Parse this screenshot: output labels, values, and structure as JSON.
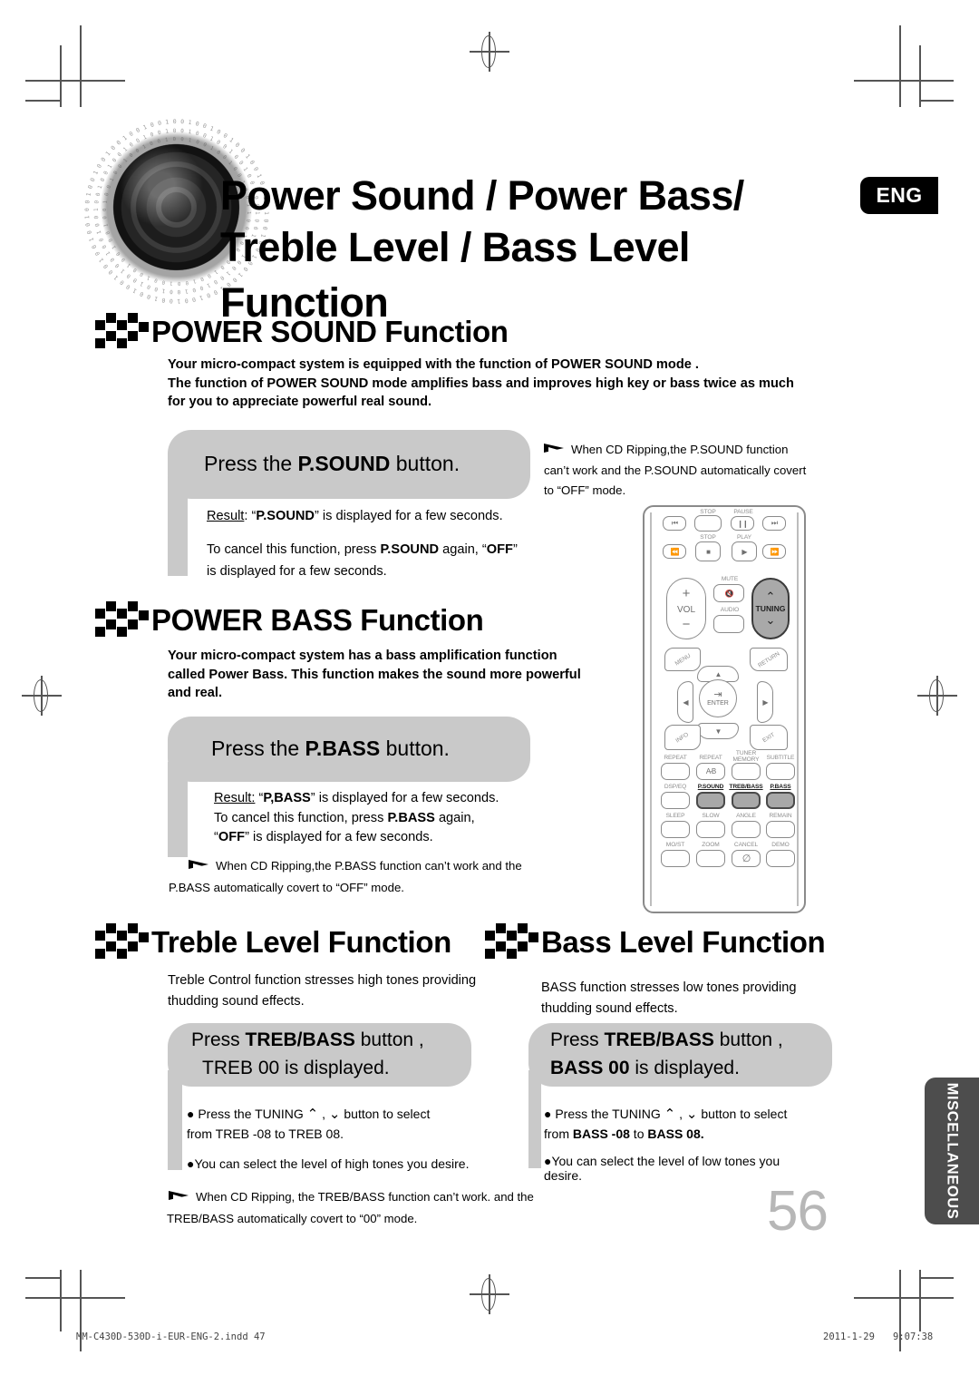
{
  "header": {
    "title_line1": "Power Sound /  Power Bass/",
    "title_line2": "Treble Level / Bass Level Function",
    "language_badge": "ENG"
  },
  "sections": {
    "power_sound": {
      "heading": "POWER SOUND Function",
      "intro_line1": "Your micro-compact system is equipped with the function of POWER SOUND mode .",
      "intro_line2": "The function of POWER SOUND mode amplifies bass and improves high key or bass twice as much",
      "intro_line3": "for you to appreciate powerful real sound.",
      "callout": "Press the P.SOUND button.",
      "callout_pre": "Press the ",
      "callout_bold": "P.SOUND",
      "callout_post": " button.",
      "result_label": "Result",
      "result_text_pre": ": “",
      "result_bold": "P.SOUND",
      "result_text_post": "” is displayed for a few seconds.",
      "cancel_line1_a": "To cancel this function, press ",
      "cancel_line1_b": "P.SOUND",
      "cancel_line1_c": " again, “",
      "cancel_line1_d": "OFF",
      "cancel_line1_e": "”",
      "cancel_line2": "is displayed  for a few seconds.",
      "note_line1": "When CD Ripping,the P.SOUND function",
      "note_line2": "can’t work and the P.SOUND automatically covert",
      "note_line3": "to “OFF” mode."
    },
    "power_bass": {
      "heading": "POWER BASS Function",
      "intro_line1": "Your micro-compact system has a bass amplification function",
      "intro_line2": "called Power Bass. This function makes the sound more powerful",
      "intro_line3": "and real.",
      "callout_pre": "Press the ",
      "callout_bold": "P.BASS",
      "callout_post": " button.",
      "result_label": "Result:",
      "result_pre": "  “",
      "result_bold": "P,BASS",
      "result_post": "” is displayed for a few seconds.",
      "cancel_line_a": "To cancel this function, press ",
      "cancel_line_b": "P.BASS",
      "cancel_line_c": " again,",
      "off_line_a": "“",
      "off_line_b": "OFF",
      "off_line_c": "” is displayed  for a few seconds.",
      "note_line1": "When CD Ripping,the P.BASS function can’t work and the",
      "note_line2": "P.BASS automatically covert to “OFF” mode."
    },
    "treble_level": {
      "heading": "Treble Level Function",
      "intro_line1": "Treble Control function stresses high tones providing",
      "intro_line2": "thudding sound effects.",
      "callout_l1_pre": "Press ",
      "callout_l1_bold": "TREB/BASS",
      "callout_l1_post": " button ,",
      "callout_l2": "TREB 00 is displayed.",
      "bullet1_pre": "● Press the TUNING ",
      "bullet1_post": " button to select",
      "bullet1_line2": "from TREB -08 to TREB  08.",
      "bullet2": "●You can select the level of high tones you desire.",
      "note_line1": "When CD Ripping, the TREB/BASS function can’t work. and the",
      "note_line2": "TREB/BASS automatically covert to “00” mode."
    },
    "bass_level": {
      "heading": "Bass Level Function",
      "intro_line1": "BASS function stresses low tones providing",
      "intro_line2": "thudding sound effects.",
      "callout_l1_pre": "Press ",
      "callout_l1_bold": "TREB/BASS",
      "callout_l1_post": " button ,",
      "callout_l2_bold": "BASS 00",
      "callout_l2_post": " is displayed.",
      "bullet1_pre": "● Press the TUNING ",
      "bullet1_post": " button to select",
      "bullet1_line2_a": "from ",
      "bullet1_line2_b": "BASS -08",
      "bullet1_line2_c": " to ",
      "bullet1_line2_d": "BASS  08.",
      "bullet2_line1": "●You can select the level of low  tones you",
      "bullet2_line2": "desire."
    }
  },
  "remote": {
    "labels": {
      "stop_top": "STOP",
      "pause_top": "PAUSE",
      "stop": "STOP",
      "play": "PLAY",
      "vol": "VOL",
      "vol_plus": "+",
      "vol_minus": "−",
      "mute": "MUTE",
      "audio": "AUDIO",
      "tuning": "TUNING",
      "menu": "MENU",
      "return": "RETURN",
      "enter": "ENTER",
      "info": "INFO",
      "exit": "EXIT",
      "repeat": "REPEAT",
      "repeat_ab": "REPEAT",
      "ab": "A-B",
      "tuner_memory_l1": "TUNER",
      "tuner_memory_l2": "MEMORY",
      "subtitle": "SUBTITLE",
      "dsp_eq": "DSP/EQ",
      "p_sound": "P.SOUND",
      "treb_bass": "TREB/BASS",
      "p_bass": "P.BASS",
      "sleep": "SLEEP",
      "slow": "SLOW",
      "angle": "ANGLE",
      "remain": "REMAIN",
      "moist": "MO/ST",
      "zoom": "ZOOM",
      "cancel": "CANCEL",
      "demo": "DEMO"
    }
  },
  "side_tab": "MISCELLANEOUS",
  "page_number": "56",
  "footer": {
    "file": "MM-C430D-530D-i-EUR-ENG-2.indd   47",
    "date": "2011-1-29",
    "time": "9:07:38"
  },
  "colors": {
    "callout_gray": "#c9c9c9",
    "tab_gray": "#4d4d4d",
    "page_number_gray": "#b7b7b7",
    "badge_black": "#000000"
  }
}
